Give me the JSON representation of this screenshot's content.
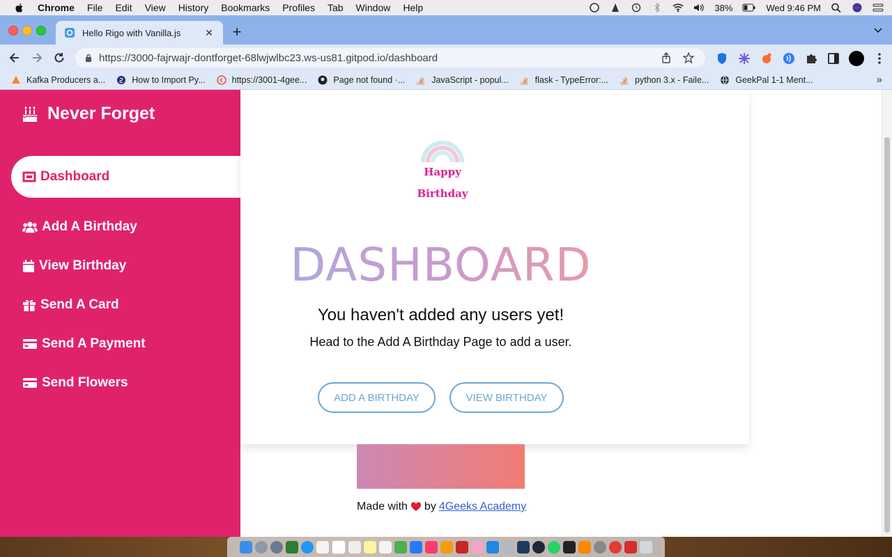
{
  "menubar": {
    "app": "Chrome",
    "items": [
      "File",
      "Edit",
      "View",
      "History",
      "Bookmarks",
      "Profiles",
      "Tab",
      "Window",
      "Help"
    ],
    "battery": "38%",
    "clock": "Wed 9:46 PM"
  },
  "browser": {
    "tab_title": "Hello Rigo with Vanilla.js",
    "url": "https://3000-fajrwajr-dontforget-68lwjwlbc23.ws-us81.gitpod.io/dashboard",
    "bookmarks": [
      {
        "label": "Kafka Producers a..."
      },
      {
        "label": "How to Import Py..."
      },
      {
        "label": "https://3001-4gee..."
      },
      {
        "label": "Page not found ·..."
      },
      {
        "label": "JavaScript - popul..."
      },
      {
        "label": "flask - TypeError:..."
      },
      {
        "label": "python 3.x - Faile..."
      },
      {
        "label": "GeekPal 1-1 Ment..."
      }
    ],
    "bookmarks_more": "»"
  },
  "sidebar": {
    "brand": "Never Forget",
    "items": [
      {
        "label": "Dashboard",
        "icon": "dashboard-icon",
        "active": true
      },
      {
        "label": "Add A Birthday",
        "icon": "users-icon"
      },
      {
        "label": "View Birthday",
        "icon": "calendar-icon"
      },
      {
        "label": "Send A Card",
        "icon": "gift-icon"
      },
      {
        "label": "Send A Payment",
        "icon": "credit-card-icon"
      },
      {
        "label": "Send Flowers",
        "icon": "credit-card-icon"
      }
    ]
  },
  "main": {
    "logo_line1": "Happy",
    "logo_line2": "Birthday",
    "heading": "DASHBOARD",
    "subtitle": "You haven't added any users yet!",
    "description": "Head to the Add A Birthday Page to add a user.",
    "buttons": {
      "add": "Add A Birthday",
      "view": "View Birthday"
    }
  },
  "footer": {
    "made_with": "Made with",
    "by": "by",
    "link": "4Geeks Academy"
  },
  "colors": {
    "sidebar": "#e0226d",
    "button_outline": "#6ea6d2",
    "heading_gradient": [
      "#a9abde",
      "#f09a9a"
    ],
    "tabstrip": "#8db2ea"
  }
}
